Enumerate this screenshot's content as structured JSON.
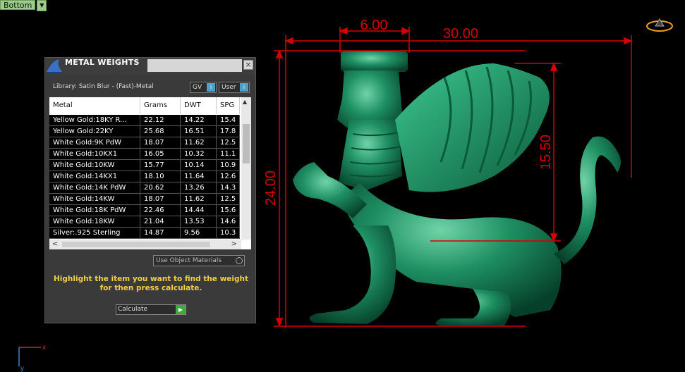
{
  "viewport": {
    "label": "Bottom"
  },
  "dimensions": {
    "d1": "6.00",
    "d2": "30.00",
    "d3": "24.00",
    "d4": "15.50"
  },
  "axis": {
    "x": "x",
    "y": "y"
  },
  "panel": {
    "title": "METAL WEIGHTS",
    "close": "×",
    "library": "Library: Satin Blur - (Fast)-Metal",
    "gv": "GV",
    "user": "User",
    "columns": [
      "Metal",
      "Grams",
      "DWT",
      "SPG"
    ],
    "rows": [
      [
        "Yellow Gold:18KY R...",
        "22.12",
        "14.22",
        "15.4"
      ],
      [
        "Yellow Gold:22KY",
        "25.68",
        "16.51",
        "17.8"
      ],
      [
        "White Gold:9K PdW",
        "18.07",
        "11.62",
        "12.5"
      ],
      [
        "White Gold:10KX1",
        "16.05",
        "10.32",
        "11.1"
      ],
      [
        "White Gold:10KW",
        "15.77",
        "10.14",
        "10.9"
      ],
      [
        "White Gold:14KX1",
        "18.10",
        "11.64",
        "12.6"
      ],
      [
        "White Gold:14K PdW",
        "20.62",
        "13.26",
        "14.3"
      ],
      [
        "White Gold:14KW",
        "18.07",
        "11.62",
        "12.5"
      ],
      [
        "White Gold:18K PdW",
        "22.46",
        "14.44",
        "15.6"
      ],
      [
        "White Gold:18KW",
        "21.04",
        "13.53",
        "14.6"
      ],
      [
        "Silver:.925 Sterling",
        "14.87",
        "9.56",
        "10.3"
      ]
    ],
    "use_object_materials": "Use Object Materials",
    "hint": "Highlight the item you want to find the weight for then press calculate.",
    "calculate": "Calculate"
  }
}
